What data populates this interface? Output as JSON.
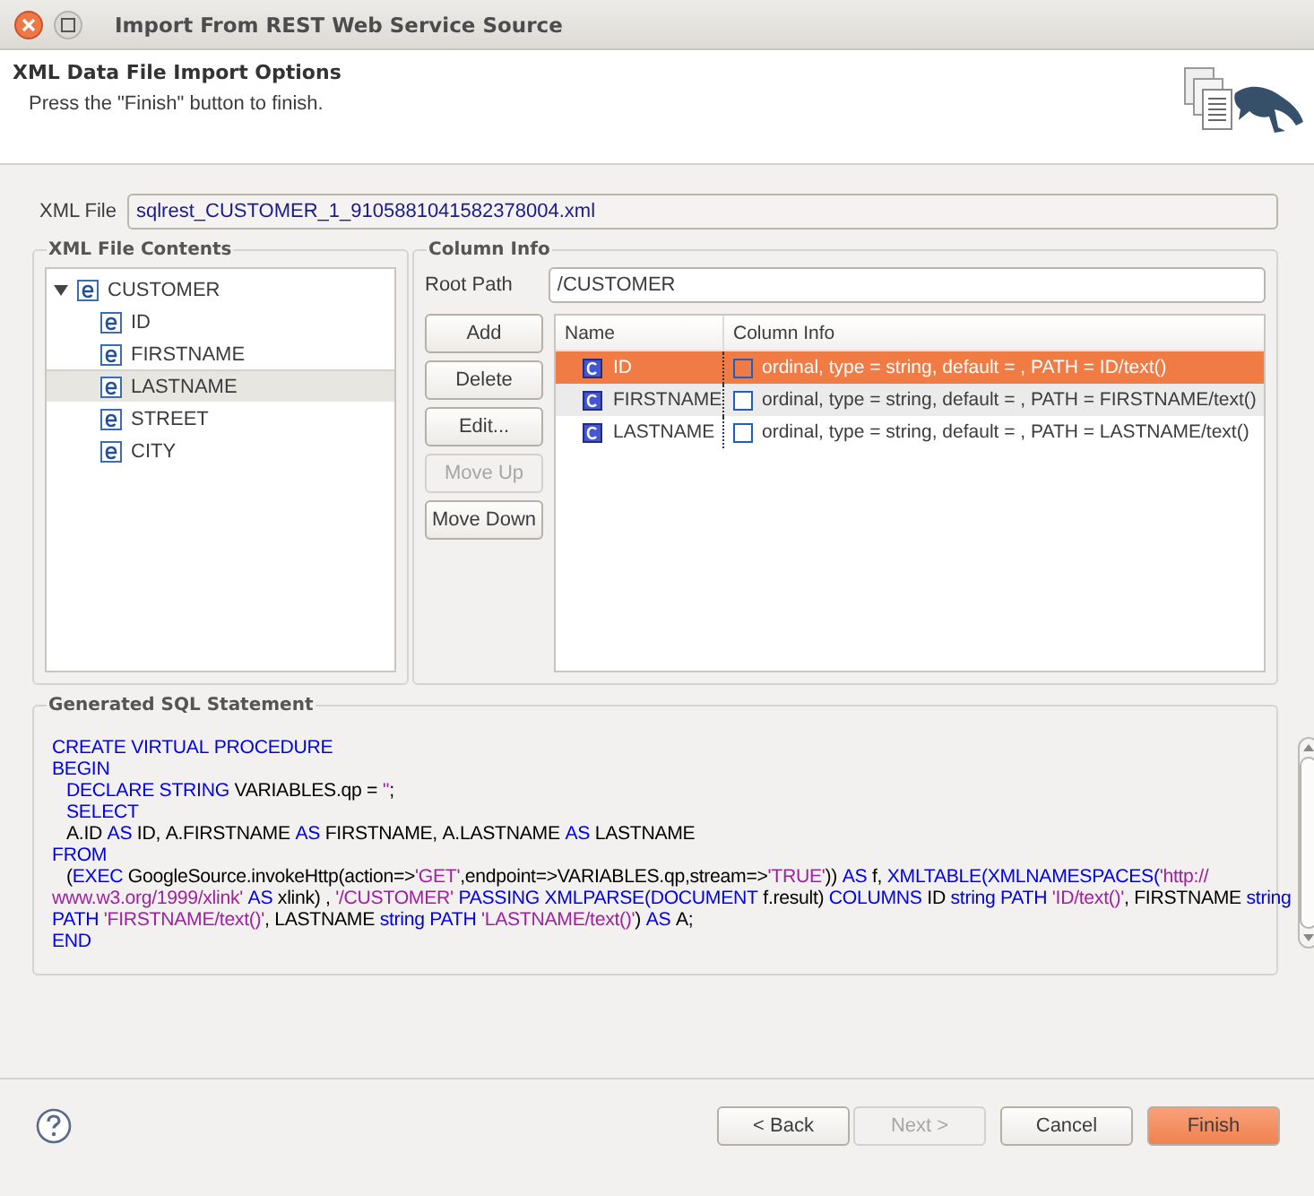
{
  "window": {
    "title": "Import From REST Web Service Source"
  },
  "header": {
    "title": "XML Data File Import Options",
    "message": "Press the \"Finish\" button to finish."
  },
  "xml_file": {
    "label": "XML File",
    "value": "sqlrest_CUSTOMER_1_9105881041582378004.xml"
  },
  "contents": {
    "title": "XML File Contents",
    "tree": [
      {
        "label": "CUSTOMER",
        "expanded": true,
        "selected": false,
        "children": [
          {
            "label": "ID",
            "selected": false
          },
          {
            "label": "FIRSTNAME",
            "selected": false
          },
          {
            "label": "LASTNAME",
            "selected": true
          },
          {
            "label": "STREET",
            "selected": false
          },
          {
            "label": "CITY",
            "selected": false
          }
        ]
      }
    ]
  },
  "column_info": {
    "title": "Column Info",
    "root_path": {
      "label": "Root Path",
      "value": "/CUSTOMER"
    },
    "buttons": [
      {
        "label": "Add",
        "disabled": false
      },
      {
        "label": "Delete",
        "disabled": false
      },
      {
        "label": "Edit...",
        "disabled": false
      },
      {
        "label": "Move Up",
        "disabled": true
      },
      {
        "label": "Move Down",
        "disabled": false
      }
    ],
    "columns": [
      "Name",
      "Column Info"
    ],
    "rows": [
      {
        "name": "ID",
        "info": "ordinal, type = string, default = , PATH = ID/text()",
        "checked": false,
        "selected": true,
        "hovered": false
      },
      {
        "name": "FIRSTNAME",
        "info": "ordinal, type = string, default = , PATH = FIRSTNAME/text()",
        "checked": false,
        "selected": false,
        "hovered": true
      },
      {
        "name": "LASTNAME",
        "info": "ordinal, type = string, default = , PATH = LASTNAME/text()",
        "checked": false,
        "selected": false,
        "hovered": false
      }
    ]
  },
  "sql": {
    "title": "Generated SQL Statement",
    "lines": [
      {
        "indent": false,
        "tokens": [
          {
            "kind": "keyword",
            "text": "CREATE VIRTUAL PROCEDURE"
          }
        ]
      },
      {
        "indent": false,
        "tokens": [
          {
            "kind": "keyword",
            "text": "BEGIN"
          }
        ]
      },
      {
        "indent": true,
        "tokens": [
          {
            "kind": "keyword",
            "text": "DECLARE STRING"
          },
          {
            "kind": "plain",
            "text": " VARIABLES.qp = "
          },
          {
            "kind": "string",
            "text": "''"
          },
          {
            "kind": "plain",
            "text": ";"
          }
        ]
      },
      {
        "indent": true,
        "tokens": [
          {
            "kind": "keyword",
            "text": "SELECT"
          }
        ]
      },
      {
        "indent": true,
        "tokens": [
          {
            "kind": "plain",
            "text": "A.ID "
          },
          {
            "kind": "keyword",
            "text": "AS"
          },
          {
            "kind": "plain",
            "text": " ID, A.FIRSTNAME "
          },
          {
            "kind": "keyword",
            "text": "AS"
          },
          {
            "kind": "plain",
            "text": " FIRSTNAME, A.LASTNAME "
          },
          {
            "kind": "keyword",
            "text": "AS"
          },
          {
            "kind": "plain",
            "text": " LASTNAME"
          }
        ]
      },
      {
        "indent": false,
        "tokens": [
          {
            "kind": "keyword",
            "text": "FROM"
          }
        ]
      },
      {
        "indent": true,
        "tokens": [
          {
            "kind": "plain",
            "text": "("
          },
          {
            "kind": "keyword",
            "text": "EXEC"
          },
          {
            "kind": "plain",
            "text": " GoogleSource.invokeHttp(action=>"
          },
          {
            "kind": "string",
            "text": "'GET'"
          },
          {
            "kind": "plain",
            "text": ",endpoint=>VARIABLES.qp,stream=>"
          },
          {
            "kind": "string",
            "text": "'TRUE'"
          },
          {
            "kind": "plain",
            "text": ")) "
          },
          {
            "kind": "keyword",
            "text": "AS"
          },
          {
            "kind": "plain",
            "text": " f, "
          },
          {
            "kind": "keyword",
            "text": "XMLTABLE(XMLNAMESPACES("
          },
          {
            "kind": "string",
            "text": "'http://"
          }
        ]
      },
      {
        "indent": false,
        "tokens": [
          {
            "kind": "string",
            "text": "www.w3.org/1999/xlink'"
          },
          {
            "kind": "keyword",
            "text": " AS"
          },
          {
            "kind": "plain",
            "text": " xlink) , "
          },
          {
            "kind": "string",
            "text": "'/CUSTOMER'"
          },
          {
            "kind": "keyword",
            "text": " PASSING XMLPARSE(DOCUMENT"
          },
          {
            "kind": "plain",
            "text": " f.result) "
          },
          {
            "kind": "keyword",
            "text": "COLUMNS"
          },
          {
            "kind": "plain",
            "text": " ID "
          },
          {
            "kind": "keyword",
            "text": "string PATH "
          },
          {
            "kind": "string",
            "text": "'ID/text()'"
          },
          {
            "kind": "plain",
            "text": ", FIRSTNAME "
          },
          {
            "kind": "keyword",
            "text": "string"
          }
        ]
      },
      {
        "indent": false,
        "tokens": [
          {
            "kind": "keyword",
            "text": "PATH "
          },
          {
            "kind": "string",
            "text": "'FIRSTNAME/text()'"
          },
          {
            "kind": "plain",
            "text": ", LASTNAME "
          },
          {
            "kind": "keyword",
            "text": "string PATH "
          },
          {
            "kind": "string",
            "text": "'LASTNAME/text()'"
          },
          {
            "kind": "plain",
            "text": ") "
          },
          {
            "kind": "keyword",
            "text": "AS"
          },
          {
            "kind": "plain",
            "text": " A;"
          }
        ]
      },
      {
        "indent": false,
        "tokens": [
          {
            "kind": "keyword",
            "text": "END"
          }
        ]
      }
    ]
  },
  "footer": {
    "buttons": [
      {
        "label": "< Back",
        "kind": "normal",
        "disabled": false
      },
      {
        "label": "Next >",
        "kind": "normal",
        "disabled": true
      },
      {
        "label": "Cancel",
        "kind": "normal",
        "disabled": false
      },
      {
        "label": "Finish",
        "kind": "primary",
        "disabled": false
      }
    ]
  }
}
